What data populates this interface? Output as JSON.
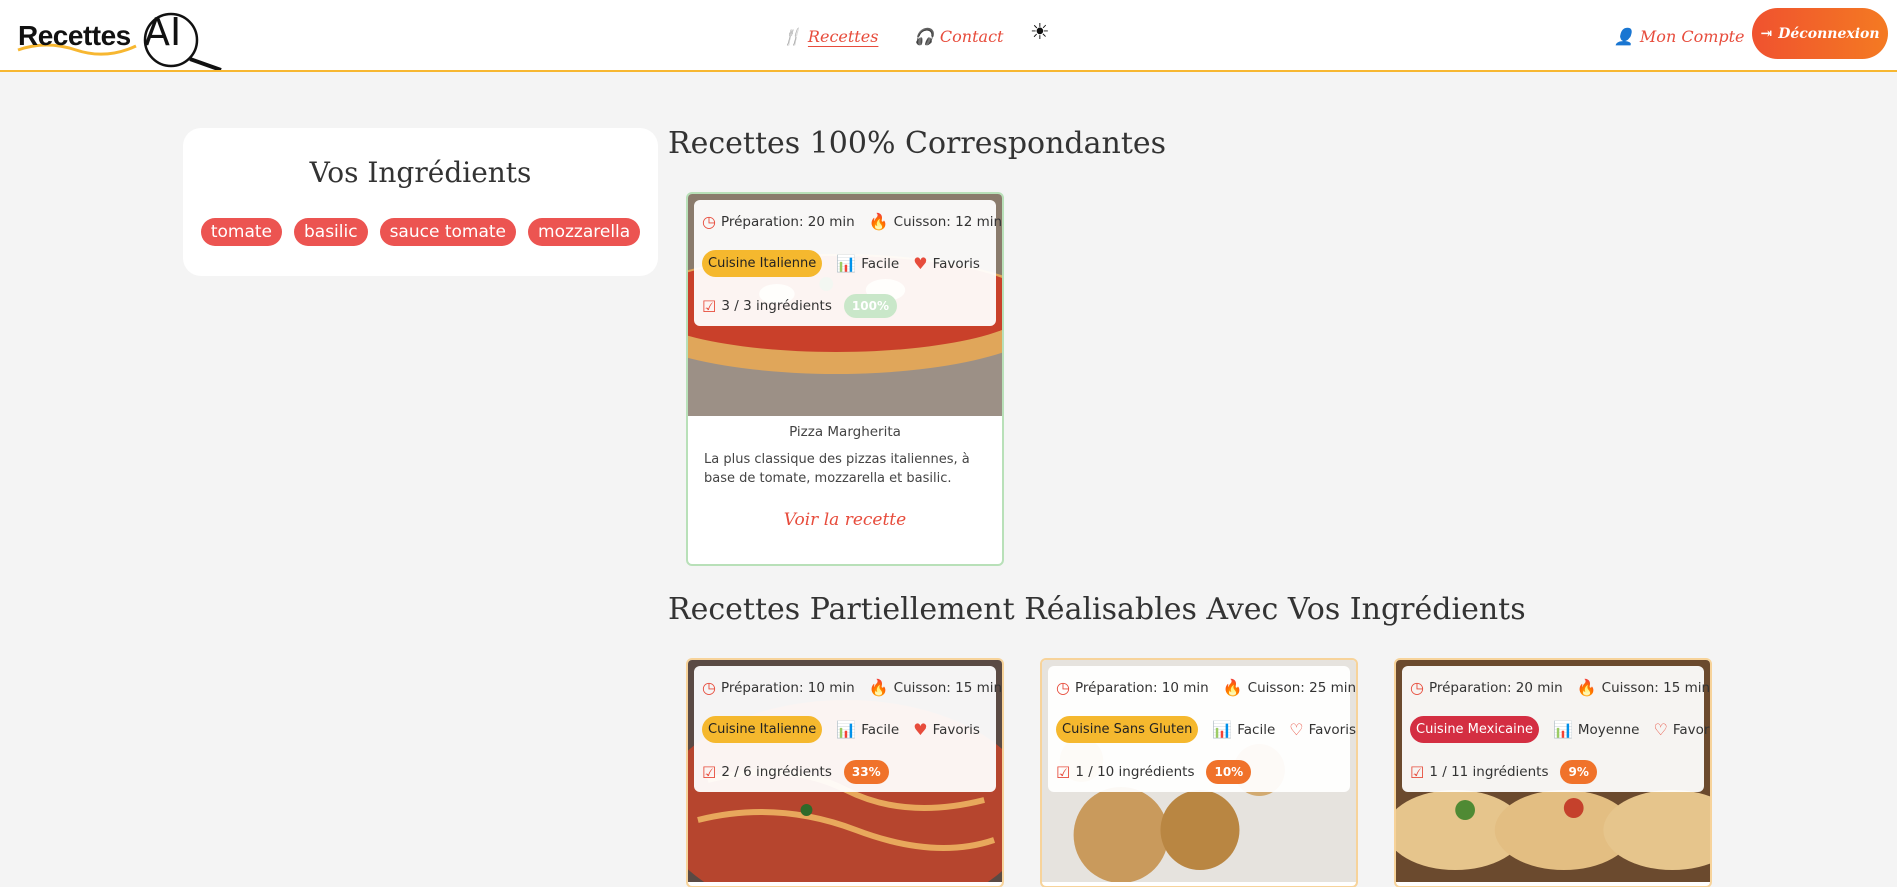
{
  "header": {
    "logo_text": "Recettes",
    "logo_ai": "AI",
    "nav": [
      {
        "label": "Recettes"
      },
      {
        "label": "Contact"
      }
    ],
    "theme_toggle_icon": "sun-icon",
    "account_label": "Mon Compte",
    "logout_label": "Déconnexion"
  },
  "ingredients": {
    "title": "Vos Ingrédients",
    "items": [
      "tomate",
      "basilic",
      "sauce tomate",
      "mozzarella"
    ]
  },
  "sections": {
    "full_title": "Recettes 100% Correspondantes",
    "partial_title": "Recettes Partiellement Réalisables Avec Vos Ingrédients"
  },
  "full_recipes": [
    {
      "prep": "Préparation: 20 min",
      "cook": "Cuisson: 12 min",
      "cuisine": "Cuisine Italienne",
      "difficulty": "Facile",
      "favorite": "Favoris",
      "ingredients_count": "3 / 3 ingrédients",
      "match": "100%",
      "name": "Pizza Margherita",
      "description": "La plus classique des pizzas italiennes, à base de tomate, mozzarella et basilic.",
      "link": "Voir la recette"
    }
  ],
  "partial_recipes": [
    {
      "prep": "Préparation: 10 min",
      "cook": "Cuisson: 15 min",
      "cuisine": "Cuisine Italienne",
      "difficulty": "Facile",
      "favorite": "Favoris",
      "ingredients_count": "2 / 6 ingrédients",
      "match": "33%"
    },
    {
      "prep": "Préparation: 10 min",
      "cook": "Cuisson: 25 min",
      "cuisine": "Cuisine Sans Gluten",
      "difficulty": "Facile",
      "favorite": "Favoris",
      "ingredients_count": "1 / 10 ingrédients",
      "match": "10%"
    },
    {
      "prep": "Préparation: 20 min",
      "cook": "Cuisson: 15 min",
      "cuisine": "Cuisine Mexicaine",
      "difficulty": "Moyenne",
      "favorite": "Favoris",
      "ingredients_count": "1 / 11 ingrédients",
      "match": "9%"
    }
  ],
  "colors": {
    "accent": "#e74c3c",
    "brand_orange": "#f47a22",
    "cuisine_yellow": "#f5b82e",
    "cuisine_red": "#d42e42",
    "match_green": "#c9e7c9"
  }
}
